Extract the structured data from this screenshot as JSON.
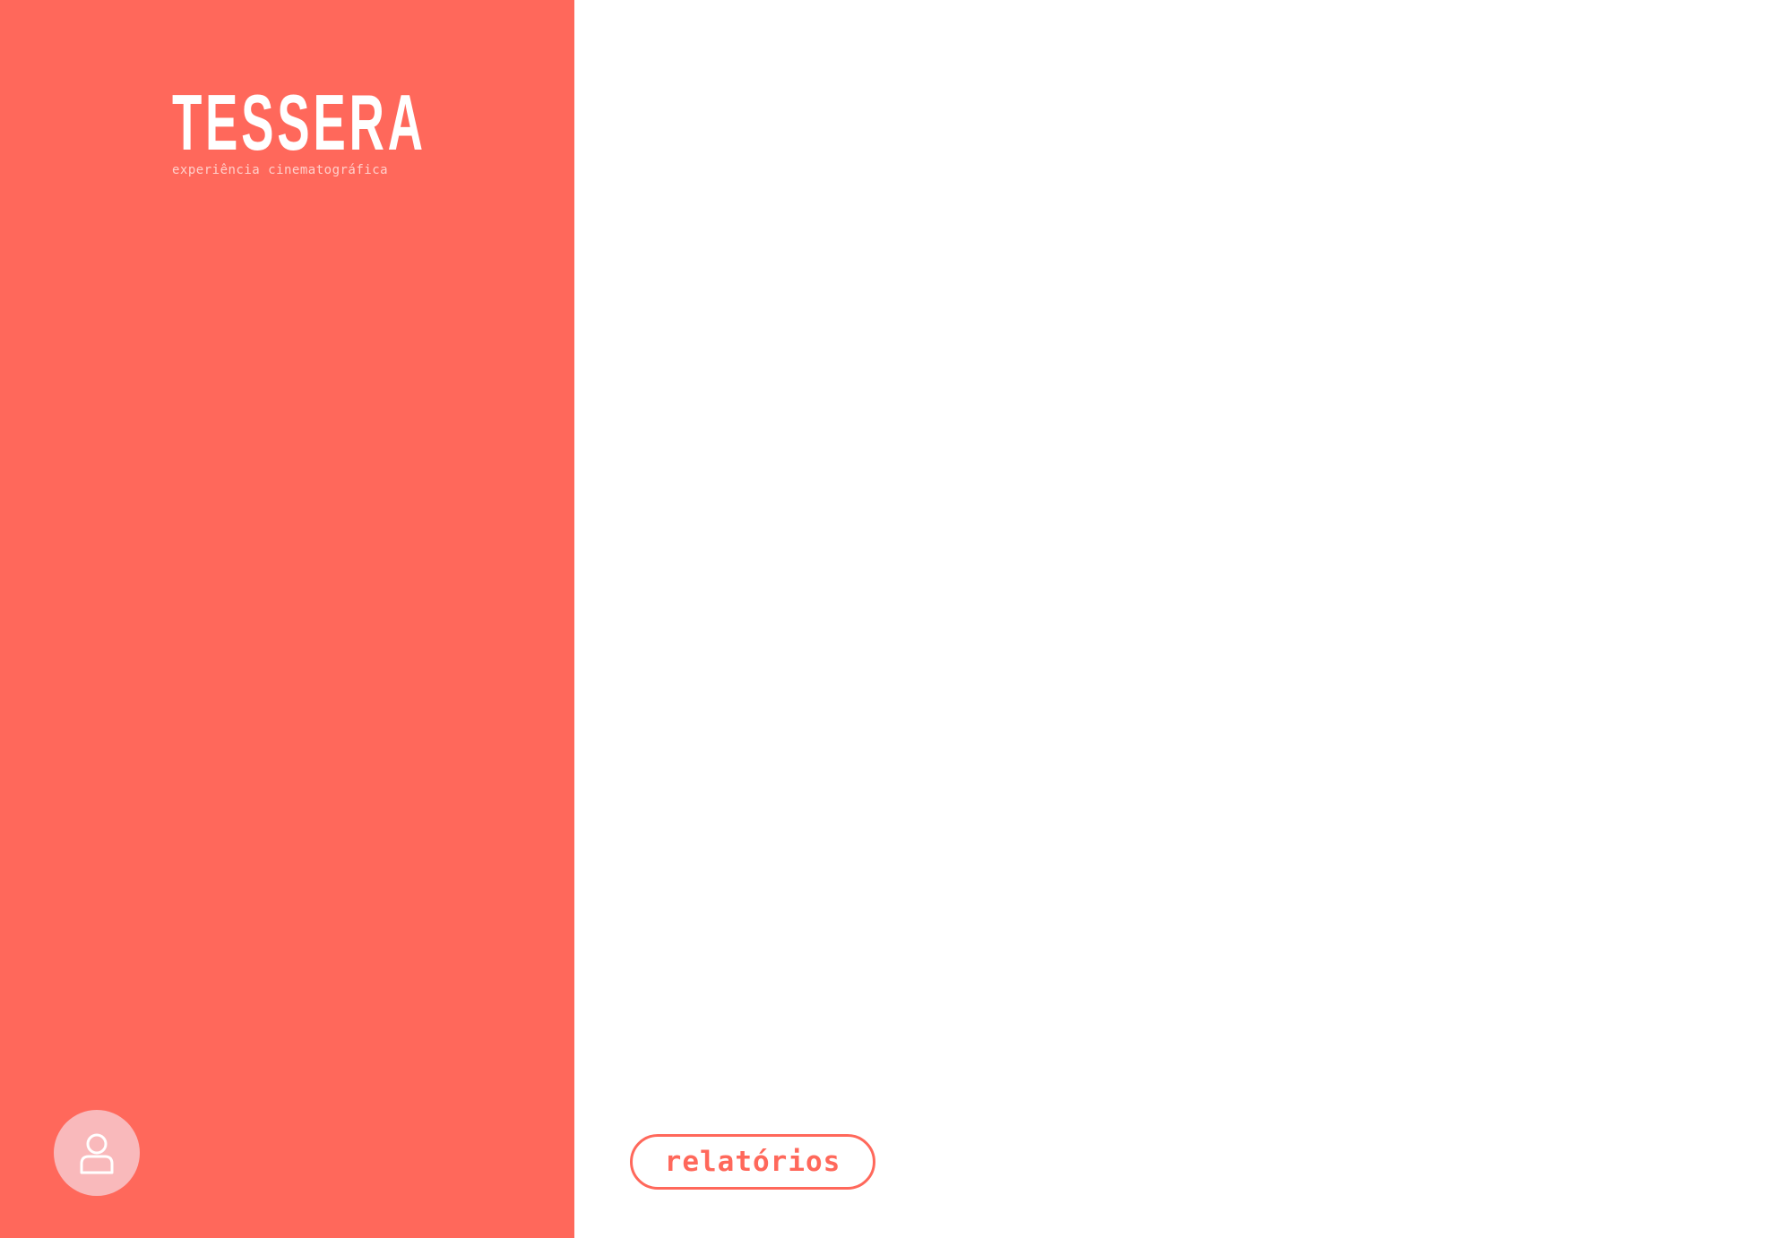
{
  "brand": {
    "title": "TESSERA",
    "subtitle": "experiência cinematográfica"
  },
  "sidebar": {
    "user_icon": "user-icon"
  },
  "main": {
    "reports_label": "relatórios"
  },
  "colors": {
    "accent": "#ff685b",
    "user_button_bg": "#f9b9bb",
    "background": "#ffffff"
  }
}
